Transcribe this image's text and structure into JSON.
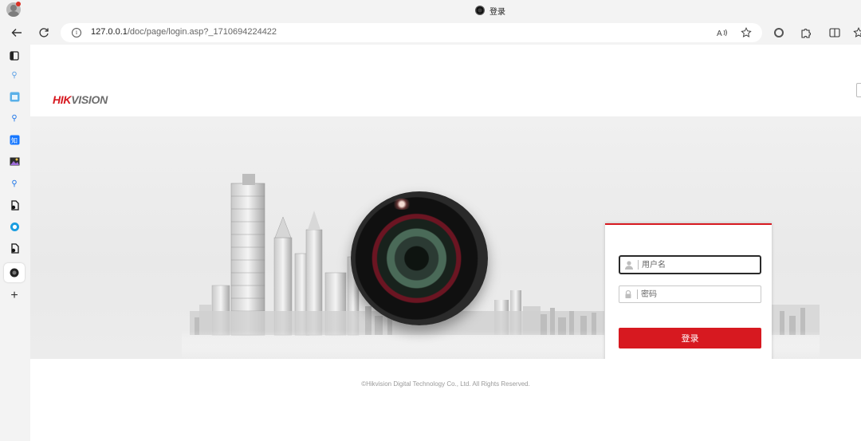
{
  "window": {
    "tab_title": "登录"
  },
  "address_bar": {
    "url_host": "127.0.0.1",
    "url_path": "/doc/page/login.asp?_1710694224422"
  },
  "icons": {
    "back": "arrow-left-icon",
    "reload": "reload-icon",
    "info": "info-icon",
    "read_aloud": "read-aloud-icon",
    "favorite": "star-icon",
    "extensions": "puzzle-icon",
    "split": "split-screen-icon",
    "add": "plus-icon"
  },
  "page": {
    "logo_red": "HIK",
    "logo_grey": "VISION",
    "login": {
      "username_placeholder": "用户名",
      "password_placeholder": "密码",
      "submit_label": "登录"
    },
    "copyright": "©Hikvision Digital Technology Co., Ltd. All Rights Reserved."
  },
  "colors": {
    "brand_red": "#d71920",
    "browser_chrome": "#f3f3f3"
  }
}
